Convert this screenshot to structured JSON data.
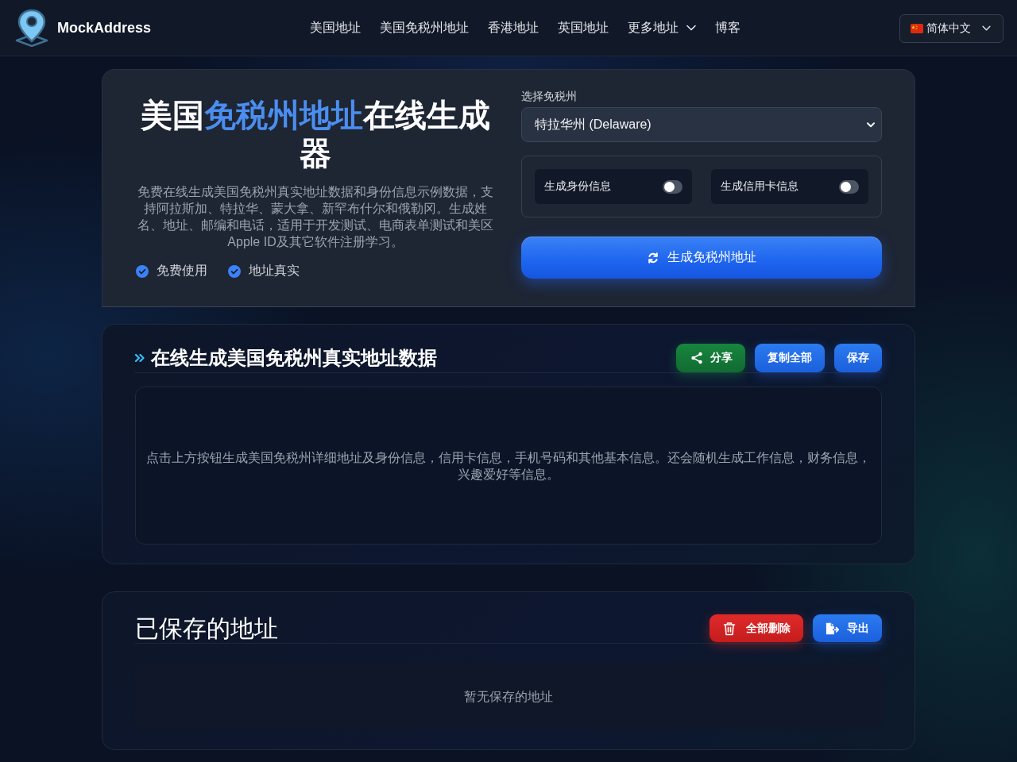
{
  "header": {
    "logo_text": "MockAddress",
    "nav": [
      {
        "label": "美国地址",
        "kind": "link"
      },
      {
        "label": "美国免税州地址",
        "kind": "link"
      },
      {
        "label": "香港地址",
        "kind": "link"
      },
      {
        "label": "英国地址",
        "kind": "link"
      },
      {
        "label": "更多地址",
        "kind": "dropdown"
      },
      {
        "label": "博客",
        "kind": "link"
      }
    ],
    "language": {
      "label": "简体中文"
    }
  },
  "hero": {
    "title": [
      {
        "text": "美国",
        "highlight": false
      },
      {
        "text": "免税州地址",
        "highlight": true
      },
      {
        "text": "在线生成器",
        "highlight": false
      }
    ],
    "description": "免费在线生成美国免税州真实地址数据和身份信息示例数据，支持阿拉斯加、特拉华、蒙大拿、新罕布什尔和俄勒冈。生成姓名、地址、邮编和电话，适用于开发测试、电商表单测试和美区Apple ID及其它软件注册学习。",
    "features": [
      {
        "label": "免费使用"
      },
      {
        "label": "地址真实"
      }
    ],
    "state_select": {
      "label": "选择免税州",
      "value": "特拉华州 (Delaware)"
    },
    "toggles": [
      {
        "label": "生成身份信息",
        "on": false
      },
      {
        "label": "生成信用卡信息",
        "on": false
      }
    ],
    "generate_button": "生成免税州地址"
  },
  "result": {
    "title": "在线生成美国免税州真实地址数据",
    "actions": [
      {
        "label": "分享",
        "kind": "share"
      },
      {
        "label": "复制全部",
        "kind": "copy"
      },
      {
        "label": "保存",
        "kind": "save"
      }
    ],
    "placeholder": "点击上方按钮生成美国免税州详细地址及身份信息，信用卡信息，手机号码和其他基本信息。还会随机生成工作信息，财务信息，兴趣爱好等信息。"
  },
  "saved": {
    "title": "已保存的地址",
    "actions": [
      {
        "label": "全部删除",
        "kind": "delete"
      },
      {
        "label": "导出",
        "kind": "export"
      }
    ],
    "empty_text": "暂无保存的地址"
  }
}
